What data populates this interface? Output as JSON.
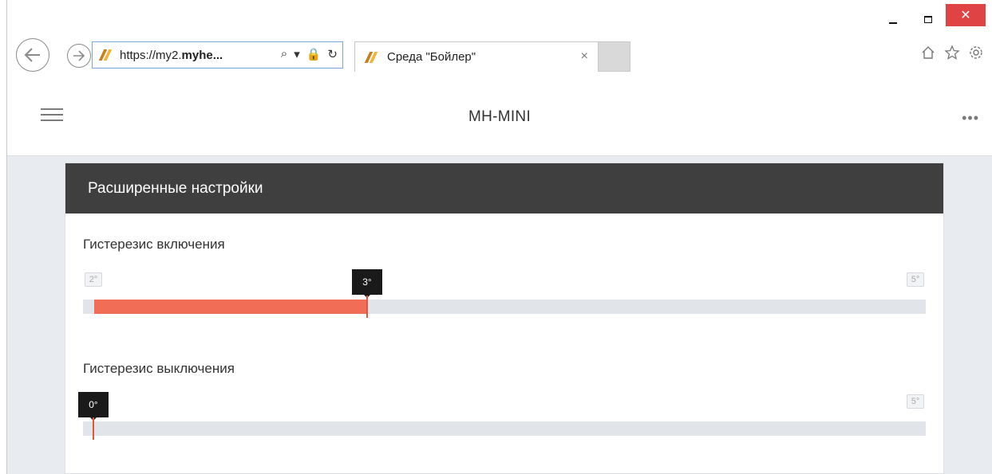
{
  "browser": {
    "address": {
      "url_prefix": "https://my2.",
      "url_bold": "myhe...",
      "icons": [
        "search-icon",
        "dropdown-icon",
        "lock-icon",
        "refresh-icon"
      ]
    },
    "tab": {
      "title": "Среда \"Бойлер\"",
      "close": "×"
    },
    "window_controls": {
      "close": "✕"
    },
    "right_icons": [
      "home-icon",
      "star-icon",
      "gear-icon"
    ]
  },
  "app": {
    "title": "MH-MINI",
    "more": "•••"
  },
  "panel": {
    "title": "Расширенные настройки",
    "settings": [
      {
        "label": "Гистерезис включения",
        "min_label": "2°",
        "max_label": "5°",
        "value_label": "3°",
        "min": 2,
        "max": 5,
        "value": 3
      },
      {
        "label": "Гистерезис выключения",
        "min_label": "",
        "max_label": "5°",
        "value_label": "0°",
        "min": 0,
        "max": 5,
        "value": 0
      }
    ]
  },
  "colors": {
    "accent": "#f26d55",
    "header_bg": "#3f3f3f",
    "track": "#e1e4e8"
  }
}
